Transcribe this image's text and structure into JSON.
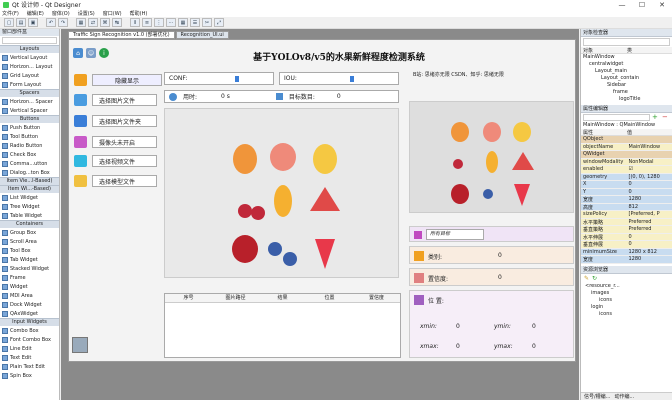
{
  "window": {
    "title": "Qt 设计师 - Qt Designer"
  },
  "menu": [
    "文件(F)",
    "编辑(E)",
    "窗体(O)",
    "设置(S)",
    "窗口(W)",
    "帮助(H)"
  ],
  "widgetbox": {
    "title": "窗口部件盒",
    "categories": [
      {
        "label": "Layouts",
        "items": [
          "Vertical Layout",
          "Horizon... Layout",
          "Grid Layout",
          "Form Layout"
        ]
      },
      {
        "label": "Spacers",
        "items": [
          "Horizon... Spacer",
          "Vertical Spacer"
        ]
      },
      {
        "label": "Buttons",
        "items": [
          "Push Button",
          "Tool Button",
          "Radio Button",
          "Check Box",
          "Comma...utton",
          "Dialog...ton Box"
        ]
      },
      {
        "label": "Item Vie...l-Based)",
        "items": []
      },
      {
        "label": "Item Wi...-Based)",
        "items": [
          "List Widget",
          "Tree Widget",
          "Table Widget"
        ]
      },
      {
        "label": "Containers",
        "items": [
          "Group Box",
          "Scroll Area",
          "Tool Box",
          "Tab Widget",
          "Stacked Widget",
          "Frame",
          "Widget",
          "MDI Area",
          "Dock Widget",
          "QAxWidget"
        ]
      },
      {
        "label": "Input Widgets",
        "items": [
          "Combo Box",
          "Font Combo Box",
          "Line Edit",
          "Text Edit",
          "Plain Text Edit",
          "Spin Box"
        ]
      }
    ]
  },
  "tabs": [
    "Traffic Sign Recognition v1.0 (部署优化)",
    "Recognition_UI.ui"
  ],
  "app": {
    "title": "基于YOLOv8/v5的水果新鲜程度检测系统",
    "hide_button": "隐藏显示",
    "inputs": [
      "选择图片文件",
      "选择图片文件夹",
      "摄像头未开启",
      "选择视频文件",
      "选择模型文件"
    ],
    "conf_label": "CONF:",
    "iou_label": "IOU:",
    "time_label": "用时:",
    "time_value": "0 s",
    "count_label": "目标数目:",
    "count_value": "0",
    "author": "B站: 思绪亦无限  CSDN、知乎: 思绪无限",
    "table_headers": [
      "序号",
      "图片路径",
      "结果",
      "位置",
      "置信度"
    ],
    "all_targets": "所有目标",
    "category_label": "类别:",
    "category_value": "0",
    "confidence_label": "置信度:",
    "confidence_value": "0",
    "position_label": "位 置:",
    "xmin_label": "xmin:",
    "xmin_value": "0",
    "ymin_label": "ymin:",
    "ymin_value": "0",
    "xmax_label": "xmax:",
    "xmax_value": "0",
    "ymax_label": "ymax:",
    "ymax_value": "0"
  },
  "object_inspector": {
    "title": "对象检查器",
    "header": [
      "对象",
      "类"
    ],
    "rows": [
      "MainWindow",
      "centralwidget",
      "Layout_main",
      "Layout_contain",
      "Sidebar",
      "frame",
      "logoTitle"
    ]
  },
  "property_editor": {
    "title": "属性编辑器",
    "object_line": "MainWindow : QMainWindow",
    "header": [
      "属性",
      "值"
    ],
    "rows": [
      {
        "k": "QObject",
        "v": "",
        "c": "sec"
      },
      {
        "k": "objectName",
        "v": "MainWindow",
        "c": "sec2"
      },
      {
        "k": "QWidget",
        "v": "",
        "c": "sec"
      },
      {
        "k": "windowModality",
        "v": "NonModal",
        "c": "sec2"
      },
      {
        "k": "enabled",
        "v": "☑",
        "c": "sec2"
      },
      {
        "k": "geometry",
        "v": "[(0, 0), 1280",
        "c": "sec3"
      },
      {
        "k": "X",
        "v": "0",
        "c": "sec3"
      },
      {
        "k": "Y",
        "v": "0",
        "c": "sec3"
      },
      {
        "k": "宽度",
        "v": "1280",
        "c": "sec3"
      },
      {
        "k": "高度",
        "v": "812",
        "c": "sec3"
      },
      {
        "k": "sizePolicy",
        "v": "[Preferred, P",
        "c": "sec2"
      },
      {
        "k": "水平策略",
        "v": "Preferred",
        "c": "sec2"
      },
      {
        "k": "垂直策略",
        "v": "Preferred",
        "c": "sec2"
      },
      {
        "k": "水平伸展",
        "v": "0",
        "c": "sec2"
      },
      {
        "k": "垂直伸展",
        "v": "0",
        "c": "sec2"
      },
      {
        "k": "minimumSize",
        "v": "1280 x 812",
        "c": "sec3"
      },
      {
        "k": "宽度",
        "v": "1280",
        "c": "sec3"
      }
    ]
  },
  "resource_browser": {
    "title": "资源浏览器",
    "rows": [
      "<resource_r...",
      "images",
      "icons",
      "login",
      "icons"
    ],
    "bottom_tabs": [
      "信号/槽编...",
      "动作编..."
    ]
  }
}
